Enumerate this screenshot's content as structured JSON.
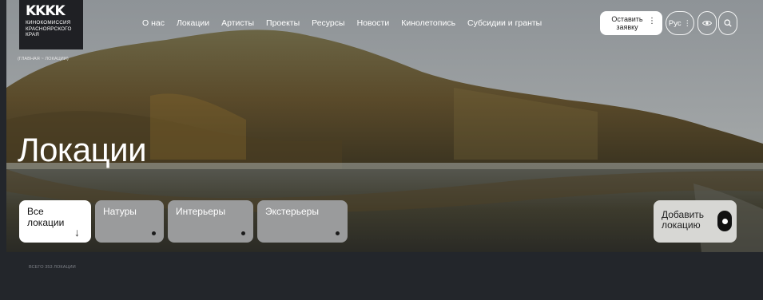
{
  "logo": {
    "mark": "KKKK",
    "name_line1": "Кинокомиссия",
    "name_line2": "Красноярского",
    "name_line3": "края"
  },
  "nav": {
    "items": [
      {
        "label": "О нас"
      },
      {
        "label": "Локации"
      },
      {
        "label": "Артисты"
      },
      {
        "label": "Проекты"
      },
      {
        "label": "Ресурсы"
      },
      {
        "label": "Новости"
      },
      {
        "label": "Кинолетопись"
      },
      {
        "label": "Субсидии и гранты"
      }
    ],
    "cta_label": "Оставить заявку",
    "cta_icon": "more-vertical-icon",
    "lang_label": "Рус",
    "lang_icon": "more-vertical-icon",
    "eye_icon": "eye-icon",
    "search_icon": "search-icon"
  },
  "breadcrumb": "(Главная ~ Локации)",
  "page_title": "Локации",
  "categories": [
    {
      "label": "Все локации",
      "active": true
    },
    {
      "label": "Натуры"
    },
    {
      "label": "Интерьеры"
    },
    {
      "label": "Экстерьеры"
    }
  ],
  "add_location_label": "Добавить локацию",
  "total_label": "Всего 353 локации",
  "colors": {
    "background": "#23262b",
    "card_inactive": "#9a9b9c",
    "card_active": "#ffffff",
    "add_button_bg": "#d7d7d4"
  }
}
